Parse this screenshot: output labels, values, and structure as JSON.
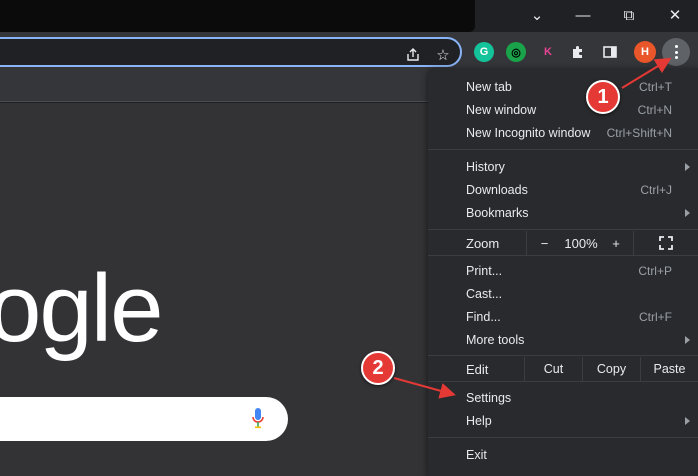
{
  "window": {
    "minimize_glyph": "⌄",
    "restore_glyph": "⧉",
    "close_glyph": "✕"
  },
  "toolbar": {
    "extensions": [
      {
        "name": "grammarly-extension",
        "glyph": "G",
        "color": "#15c39a"
      },
      {
        "name": "green-extension",
        "glyph": "◎",
        "color": "#1aa34a"
      },
      {
        "name": "k-extension",
        "glyph": "K",
        "color": "#e84393"
      }
    ],
    "profile_initial": "H",
    "profile_color": "#e8562a"
  },
  "page": {
    "logo_text": "ogle"
  },
  "menu": {
    "group1": [
      {
        "label": "New tab",
        "shortcut": "Ctrl+T"
      },
      {
        "label": "New window",
        "shortcut": "Ctrl+N"
      },
      {
        "label": "New Incognito window",
        "shortcut": "Ctrl+Shift+N"
      }
    ],
    "group2": [
      {
        "label": "History",
        "shortcut": ""
      },
      {
        "label": "Downloads",
        "shortcut": "Ctrl+J"
      },
      {
        "label": "Bookmarks",
        "shortcut": ""
      }
    ],
    "zoom": {
      "label": "Zoom",
      "minus": "−",
      "value": "100%",
      "plus": "+"
    },
    "group3": [
      {
        "label": "Print...",
        "shortcut": "Ctrl+P"
      },
      {
        "label": "Cast...",
        "shortcut": ""
      },
      {
        "label": "Find...",
        "shortcut": "Ctrl+F"
      },
      {
        "label": "More tools",
        "shortcut": ""
      }
    ],
    "edit": {
      "label": "Edit",
      "cut": "Cut",
      "copy": "Copy",
      "paste": "Paste"
    },
    "group4": [
      {
        "label": "Settings",
        "shortcut": ""
      },
      {
        "label": "Help",
        "shortcut": ""
      }
    ],
    "exit": {
      "label": "Exit"
    }
  },
  "callouts": [
    {
      "number": "1"
    },
    {
      "number": "2"
    }
  ],
  "colors": {
    "accent": "#8ab4f8",
    "callout": "#e53935"
  }
}
